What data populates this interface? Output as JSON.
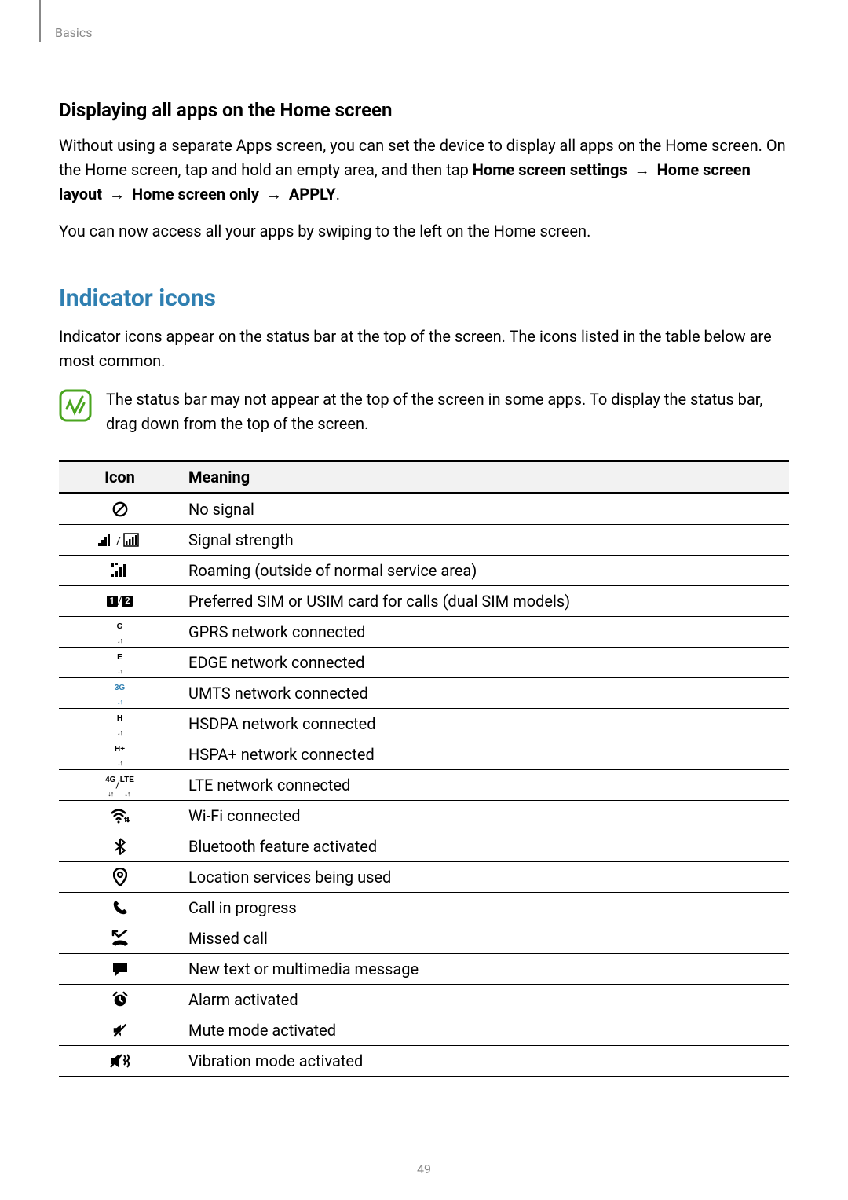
{
  "breadcrumb": "Basics",
  "page_number": "49",
  "section1": {
    "title": "Displaying all apps on the Home screen",
    "para1_pre": "Without using a separate Apps screen, you can set the device to display all apps on the Home screen. On the Home screen, tap and hold an empty area, and then tap ",
    "bold1": "Home screen settings",
    "arrow": " → ",
    "bold2": "Home screen layout",
    "bold3": "Home screen only",
    "bold4": "APPLY",
    "period": ".",
    "para2": "You can now access all your apps by swiping to the left on the Home screen."
  },
  "section2": {
    "title": "Indicator icons",
    "intro": "Indicator icons appear on the status bar at the top of the screen. The icons listed in the table below are most common.",
    "note": "The status bar may not appear at the top of the screen in some apps. To display the status bar, drag down from the top of the screen."
  },
  "table": {
    "header_icon": "Icon",
    "header_meaning": "Meaning",
    "rows": [
      {
        "icon_key": "no-signal",
        "meaning": "No signal"
      },
      {
        "icon_key": "signal-strength",
        "meaning": "Signal strength"
      },
      {
        "icon_key": "roaming",
        "meaning": "Roaming (outside of normal service area)"
      },
      {
        "icon_key": "sim-pref",
        "meaning": "Preferred SIM or USIM card for calls (dual SIM models)"
      },
      {
        "icon_key": "gprs",
        "meaning": "GPRS network connected"
      },
      {
        "icon_key": "edge",
        "meaning": "EDGE network connected"
      },
      {
        "icon_key": "umts",
        "meaning": "UMTS network connected"
      },
      {
        "icon_key": "hsdpa",
        "meaning": "HSDPA network connected"
      },
      {
        "icon_key": "hspap",
        "meaning": "HSPA+ network connected"
      },
      {
        "icon_key": "lte",
        "meaning": "LTE network connected"
      },
      {
        "icon_key": "wifi",
        "meaning": "Wi-Fi connected"
      },
      {
        "icon_key": "bluetooth",
        "meaning": "Bluetooth feature activated"
      },
      {
        "icon_key": "location",
        "meaning": "Location services being used"
      },
      {
        "icon_key": "call",
        "meaning": "Call in progress"
      },
      {
        "icon_key": "missed-call",
        "meaning": "Missed call"
      },
      {
        "icon_key": "message",
        "meaning": "New text or multimedia message"
      },
      {
        "icon_key": "alarm",
        "meaning": "Alarm activated"
      },
      {
        "icon_key": "mute",
        "meaning": "Mute mode activated"
      },
      {
        "icon_key": "vibrate",
        "meaning": "Vibration mode activated"
      }
    ]
  }
}
